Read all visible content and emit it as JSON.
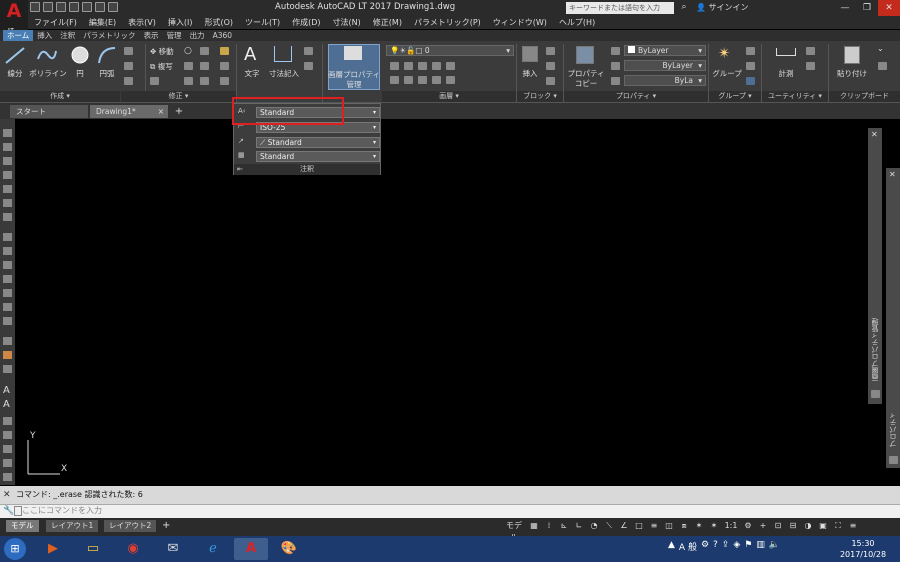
{
  "app": {
    "logo": "A",
    "logo_sub": "LT",
    "window_title": "Autodesk AutoCAD LT 2017    Drawing1.dwg",
    "search_placeholder": "キーワードまたは語句を入力",
    "signin_label": "サインイン"
  },
  "menu": [
    "ファイル(F)",
    "編集(E)",
    "表示(V)",
    "挿入(I)",
    "形式(O)",
    "ツール(T)",
    "作成(D)",
    "寸法(N)",
    "修正(M)",
    "パラメトリック(P)",
    "ウィンドウ(W)",
    "ヘルプ(H)"
  ],
  "ribbon_tabs": [
    "ホーム",
    "挿入",
    "注釈",
    "パラメトリック",
    "表示",
    "管理",
    "出力",
    "A360"
  ],
  "ribbon": {
    "draw": {
      "line": "線分",
      "polyline": "ポリライン",
      "circle": "円",
      "arc": "円弧",
      "footer": "作成 ▾"
    },
    "modify": {
      "move": "移動",
      "copy": "複写",
      "footer": "修正 ▾"
    },
    "annotation": {
      "text": "文字",
      "dimension": "寸法記入"
    },
    "layers": {
      "layer_props_1": "画層プロパティ",
      "layer_props_2": "管理",
      "layer_name": "0",
      "footer": "画層 ▾"
    },
    "block": {
      "insert": "挿入",
      "footer": "ブロック ▾"
    },
    "properties": {
      "match_1": "プロパティ",
      "match_2": "コピー",
      "color": "ByLayer",
      "linetype": "ByLayer",
      "lineweight": "ByLa",
      "footer": "プロパティ ▾"
    },
    "groups": {
      "group": "グループ",
      "footer": "グループ ▾"
    },
    "utilities": {
      "measure": "計測",
      "footer": "ユーティリティ ▾"
    },
    "clipboard": {
      "paste": "貼り付け",
      "footer": "クリップボード"
    }
  },
  "doc_tabs": {
    "start": "スタート",
    "drawing": "Drawing1*",
    "close": "×",
    "add": "+"
  },
  "annotation_panel": {
    "text_style": "Standard",
    "dim_style": "ISO-25",
    "multileader_style": "Standard",
    "table_style": "Standard",
    "footer": "注釈"
  },
  "palettes": {
    "layer_props": "画層プロパティ管理",
    "properties": "プロパティ"
  },
  "ucs": {
    "x": "X",
    "y": "Y"
  },
  "command": {
    "history": "コマンド: _.erase 認識された数: 6",
    "placeholder": "ここにコマンドを入力"
  },
  "layout_tabs": [
    "モデル",
    "レイアウト1",
    "レイアウト2"
  ],
  "status": {
    "model": "モデル",
    "scale": "1:1"
  },
  "taskbar": {
    "time": "15:30",
    "date": "2017/10/28",
    "ime": "A 般"
  }
}
